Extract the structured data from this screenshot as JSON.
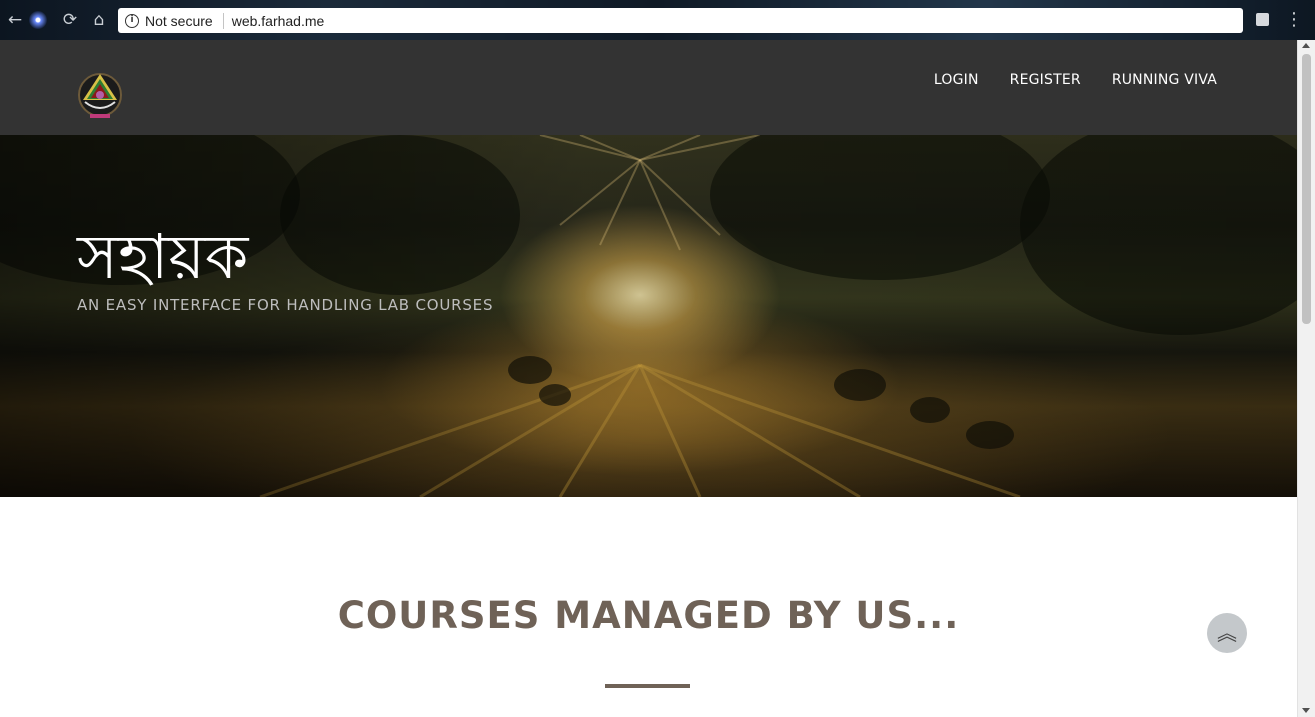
{
  "browser": {
    "back_icon": "arrow-left-icon",
    "forward_icon": "arrow-right-icon",
    "reload_icon": "reload-icon",
    "home_icon": "home-icon",
    "security_label": "Not secure",
    "url": "web.farhad.me",
    "back_glyph": "←",
    "reload_glyph": "⟳",
    "home_glyph": "⌂",
    "menu_glyph": "⋮",
    "info_glyph": "i"
  },
  "nav": {
    "links": [
      {
        "label": "LOGIN"
      },
      {
        "label": "REGISTER"
      },
      {
        "label": "RUNNING VIVA"
      }
    ]
  },
  "hero": {
    "title": "সহায়ক",
    "subtitle": "AN EASY INTERFACE FOR HANDLING LAB COURSES"
  },
  "content": {
    "section_title": "COURSES MANAGED BY US..."
  },
  "scroll_top": {
    "glyph": "︽",
    "icon": "chevron-double-up-icon"
  },
  "colors": {
    "nav_bg": "#333333",
    "section_title": "#6f6257",
    "scroll_top_bg": "#c4c8cb"
  }
}
